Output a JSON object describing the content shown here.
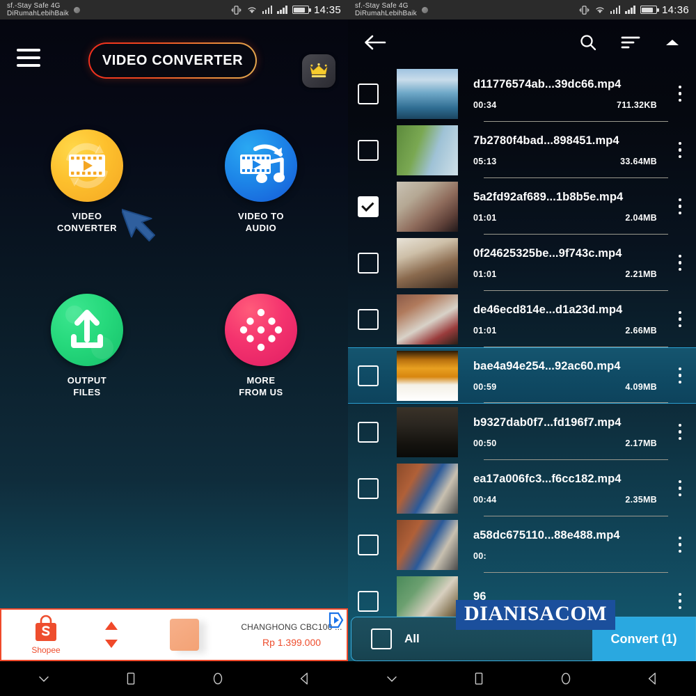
{
  "left": {
    "statusbar": {
      "carrier_line1": "sf.-Stay Safe 4G",
      "carrier_line2": "DiRumahLebihBaik",
      "time": "14:35"
    },
    "header": {
      "menu_icon": "hamburger-menu-icon",
      "title": "VIDEO CONVERTER",
      "premium_icon": "crown-icon"
    },
    "features": [
      {
        "label_line1": "VIDEO",
        "label_line2": "CONVERTER",
        "icon": "video-converter-icon",
        "color": "#f4a623"
      },
      {
        "label_line1": "VIDEO TO",
        "label_line2": "AUDIO",
        "icon": "video-to-audio-icon",
        "color": "#1558d6"
      },
      {
        "label_line1": "OUTPUT",
        "label_line2": "FILES",
        "icon": "output-files-upload-icon",
        "color": "#16c06a"
      },
      {
        "label_line1": "MORE",
        "label_line2": "FROM US",
        "icon": "more-from-us-dots-icon",
        "color": "#e01e63"
      }
    ],
    "ad": {
      "brand": "Shopee",
      "brand_icon": "shopee-bag-icon",
      "product_title": "CHANGHONG CBC100 ...",
      "price": "Rp 1.399.000",
      "up_arrow": "arrow-up-icon",
      "down_arrow": "arrow-down-icon",
      "adchoices": "adchoices-icon"
    }
  },
  "right": {
    "statusbar": {
      "carrier_line1": "sf.-Stay Safe 4G",
      "carrier_line2": "DiRumahLebihBaik",
      "time": "14:36"
    },
    "header": {
      "back_icon": "back-arrow-icon",
      "search_icon": "search-icon",
      "sort_icon": "sort-icon",
      "collapse_icon": "chevron-up-icon"
    },
    "files": [
      {
        "name": "d11776574ab...39dc66.mp4",
        "duration": "00:34",
        "size": "711.32KB",
        "checked": false,
        "highlighted": false
      },
      {
        "name": "7b2780f4bad...898451.mp4",
        "duration": "05:13",
        "size": "33.64MB",
        "checked": false,
        "highlighted": false
      },
      {
        "name": "5a2fd92af689...1b8b5e.mp4",
        "duration": "01:01",
        "size": "2.04MB",
        "checked": true,
        "highlighted": false
      },
      {
        "name": "0f24625325be...9f743c.mp4",
        "duration": "01:01",
        "size": "2.21MB",
        "checked": false,
        "highlighted": false
      },
      {
        "name": "de46ecd814e...d1a23d.mp4",
        "duration": "01:01",
        "size": "2.66MB",
        "checked": false,
        "highlighted": false
      },
      {
        "name": "bae4a94e254...92ac60.mp4",
        "duration": "00:59",
        "size": "4.09MB",
        "checked": false,
        "highlighted": true
      },
      {
        "name": "b9327dab0f7...fd196f7.mp4",
        "duration": "00:50",
        "size": "2.17MB",
        "checked": false,
        "highlighted": false
      },
      {
        "name": "ea17a006fc3...f6cc182.mp4",
        "duration": "00:44",
        "size": "2.35MB",
        "checked": false,
        "highlighted": false
      },
      {
        "name": "a58dc675110...88e488.mp4",
        "duration": "00:",
        "size": "",
        "checked": false,
        "highlighted": false
      },
      {
        "name": "96",
        "duration": "",
        "size": "",
        "checked": false,
        "highlighted": false
      }
    ],
    "watermark": "DIANISACOM",
    "actionbar": {
      "all_label": "All",
      "all_checked": false,
      "convert_label": "Convert (1)"
    }
  },
  "navbar": {
    "items": [
      {
        "icon": "chevron-down-icon"
      },
      {
        "icon": "recents-square-icon"
      },
      {
        "icon": "home-circle-icon"
      },
      {
        "icon": "back-triangle-icon"
      }
    ]
  }
}
